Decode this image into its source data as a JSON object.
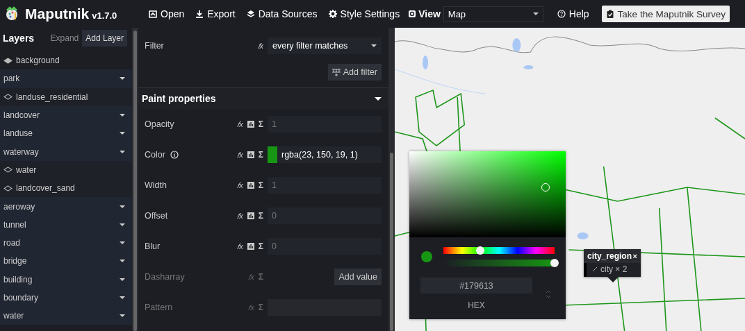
{
  "app": {
    "name": "Maputnik",
    "version": "v1.7.0"
  },
  "nav": [
    {
      "label": "Open",
      "kind": "open"
    },
    {
      "label": "Export",
      "kind": "download"
    },
    {
      "label": "Data Sources",
      "kind": "layers"
    },
    {
      "label": "Style Settings",
      "kind": "gear"
    }
  ],
  "view": {
    "label": "View",
    "value": "Map"
  },
  "help": "Help",
  "survey": "Take the Maputnik Survey",
  "layers_panel": {
    "title": "Layers",
    "expand": "Expand",
    "add": "Add Layer",
    "items": [
      {
        "name": "background",
        "kind": "background"
      },
      {
        "name": "park",
        "kind": "group",
        "children": [
          {
            "name": "landuse_residential",
            "kind": "fill"
          }
        ]
      },
      {
        "name": "landcover",
        "kind": "group"
      },
      {
        "name": "landuse",
        "kind": "group"
      },
      {
        "name": "waterway",
        "kind": "group",
        "children": [
          {
            "name": "water",
            "kind": "fill"
          },
          {
            "name": "landcover_sand",
            "kind": "fill"
          }
        ]
      },
      {
        "name": "aeroway",
        "kind": "group"
      },
      {
        "name": "tunnel",
        "kind": "group"
      },
      {
        "name": "road",
        "kind": "group"
      },
      {
        "name": "bridge",
        "kind": "group"
      },
      {
        "name": "building",
        "kind": "group"
      },
      {
        "name": "boundary",
        "kind": "group"
      },
      {
        "name": "water",
        "kind": "group"
      }
    ]
  },
  "filter": {
    "label": "Filter",
    "fx": "𝑓x",
    "value": "every filter matches",
    "add": "Add filter"
  },
  "paint": {
    "title": "Paint properties",
    "rows": [
      {
        "label": "Opacity",
        "kind": "input",
        "fx": "𝑓x",
        "sigma": "Σ",
        "placeholder": "1",
        "disabled": false
      },
      {
        "label": "Color",
        "kind": "color",
        "fx": "𝑓x",
        "sigma": "Σ",
        "value": "rgba(23, 150, 19, 1)",
        "color": "#179613",
        "info": true,
        "disabled": false
      },
      {
        "label": "Width",
        "kind": "input",
        "fx": "𝑓x",
        "sigma": "Σ",
        "placeholder": "1",
        "disabled": false
      },
      {
        "label": "Offset",
        "kind": "input",
        "fx": "𝑓x",
        "sigma": "Σ",
        "placeholder": "0",
        "disabled": false
      },
      {
        "label": "Blur",
        "kind": "input",
        "fx": "𝑓x",
        "sigma": "Σ",
        "placeholder": "0",
        "disabled": false
      },
      {
        "label": "Dasharray",
        "kind": "button",
        "fx": "𝑓x",
        "sigma": "Σ",
        "button": "Add value",
        "disabled": true
      },
      {
        "label": "Pattern",
        "kind": "input",
        "fx": "𝑓x",
        "sigma": "Σ",
        "disabled": true
      }
    ]
  },
  "color_picker": {
    "hue": {
      "level": 0.33
    },
    "alpha": {
      "level": 1
    },
    "color": "#179613",
    "hex": "#179613",
    "mode": "HEX"
  },
  "map_popup": {
    "layer": "city_region",
    "close": "×",
    "feature": "city × 2"
  }
}
